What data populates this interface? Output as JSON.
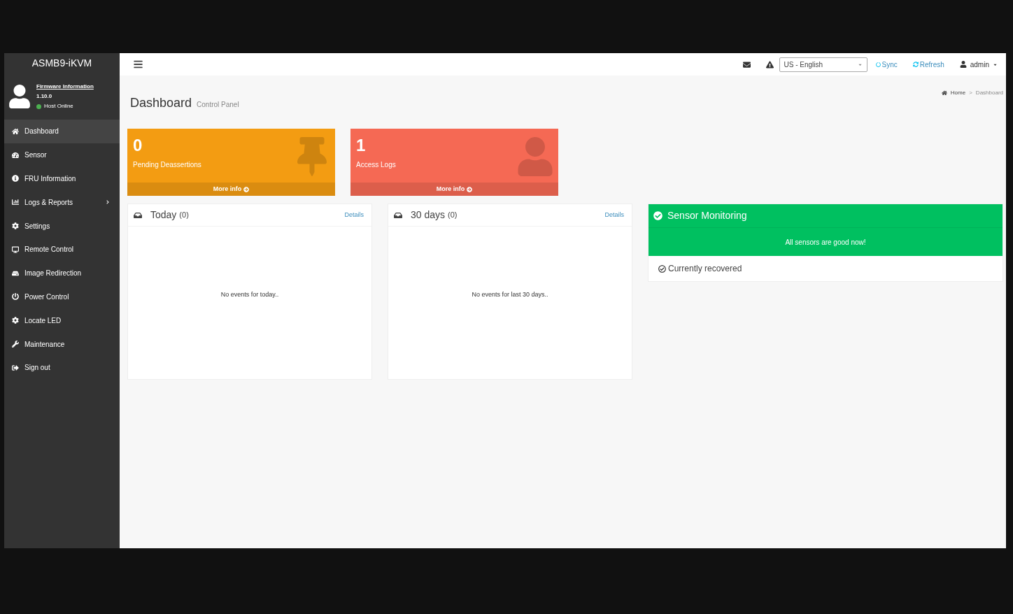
{
  "brand": "ASMB9-iKVM",
  "user_panel": {
    "link": "Firmware Information",
    "version": "1.10.0",
    "status": "Host Online"
  },
  "sidebar": {
    "items": [
      {
        "label": "Dashboard",
        "selected": true,
        "submenu": false
      },
      {
        "label": "Sensor",
        "selected": false,
        "submenu": false
      },
      {
        "label": "FRU Information",
        "selected": false,
        "submenu": false
      },
      {
        "label": "Logs & Reports",
        "selected": false,
        "submenu": true
      },
      {
        "label": "Settings",
        "selected": false,
        "submenu": false
      },
      {
        "label": "Remote Control",
        "selected": false,
        "submenu": false
      },
      {
        "label": "Image Redirection",
        "selected": false,
        "submenu": false
      },
      {
        "label": "Power Control",
        "selected": false,
        "submenu": false
      },
      {
        "label": "Locate LED",
        "selected": false,
        "submenu": false
      },
      {
        "label": "Maintenance",
        "selected": false,
        "submenu": false
      },
      {
        "label": "Sign out",
        "selected": false,
        "submenu": false
      }
    ]
  },
  "topbar": {
    "language": "US - English",
    "sync": "Sync",
    "refresh": "Refresh",
    "user": "admin"
  },
  "page": {
    "title": "Dashboard",
    "subtitle": "Control Panel",
    "breadcrumb": {
      "items": [
        "Home",
        "Dashboard"
      ],
      "separator": ">"
    }
  },
  "tiles": [
    {
      "value": "0",
      "label": "Pending Deassertions",
      "more": "More info",
      "color": "#f39c12"
    },
    {
      "value": "1",
      "label": "Access Logs",
      "more": "More info",
      "color": "#f56954"
    }
  ],
  "event_panels": [
    {
      "title": "Today",
      "count": "(0)",
      "link": "Details",
      "empty": "No events for today.."
    },
    {
      "title": "30 days",
      "count": "(0)",
      "link": "Details",
      "empty": "No events for last 30 days.."
    }
  ],
  "sensor_panel": {
    "title": "Sensor Monitoring",
    "message": "All sensors are good now!",
    "status": "Currently recovered"
  }
}
